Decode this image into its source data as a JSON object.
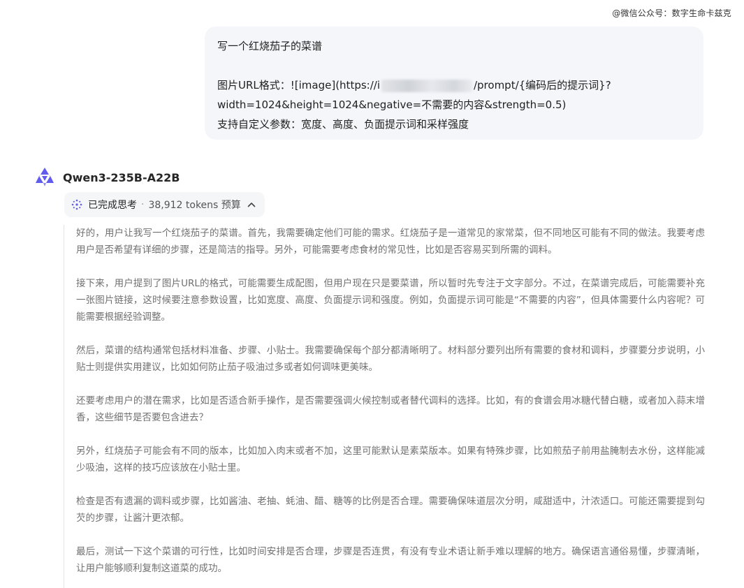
{
  "watermark": "@微信公众号：数字生命卡兹克",
  "user_message": {
    "line1": "写一个红烧茄子的菜谱",
    "line2_before": "图片URL格式：![image](https://i",
    "line2_after": "/prompt/{编码后的提示词}?",
    "line3": "width=1024&height=1024&negative=不需要的内容&strength=0.5)",
    "line4": "支持自定义参数：宽度、高度、负面提示词和采样强度"
  },
  "assistant": {
    "logo_icon": "qwen-logo-icon",
    "model_name": "Qwen3-235B-A22B",
    "logo_color": "#615ced"
  },
  "thinking": {
    "icon": "sparkle-thinking-icon",
    "status": "已完成思考",
    "separator": "·",
    "tokens": "38,912 tokens 预算",
    "toggle_icon": "chevron-up-icon",
    "paragraphs": [
      "好的，用户让我写一个红烧茄子的菜谱。首先，我需要确定他们可能的需求。红烧茄子是一道常见的家常菜，但不同地区可能有不同的做法。我要考虑用户是否希望有详细的步骤，还是简洁的指导。另外，可能需要考虑食材的常见性，比如是否容易买到所需的调料。",
      "接下来，用户提到了图片URL的格式，可能需要生成配图，但用户现在只是要菜谱，所以暂时先专注于文字部分。不过，在菜谱完成后，可能需要补充一张图片链接，这时候要注意参数设置，比如宽度、高度、负面提示词和强度。例如，负面提示词可能是“不需要的内容”，但具体需要什么内容呢？可能需要根据经验调整。",
      "然后，菜谱的结构通常包括材料准备、步骤、小贴士。我需要确保每个部分都清晰明了。材料部分要列出所有需要的食材和调料，步骤要分步说明，小贴士则提供实用建议，比如如何防止茄子吸油过多或者如何调味更美味。",
      "还要考虑用户的潜在需求，比如是否适合新手操作，是否需要强调火候控制或者替代调料的选择。比如，有的食谱会用冰糖代替白糖，或者加入蒜末增香，这些细节是否要包含进去？",
      "另外，红烧茄子可能会有不同的版本，比如加入肉末或者不加，这里可能默认是素菜版本。如果有特殊步骤，比如煎茄子前用盐腌制去水份，这样能减少吸油，这样的技巧应该放在小贴士里。",
      "检查是否有遗漏的调料或步骤，比如酱油、老抽、蚝油、醋、糖等的比例是否合理。需要确保味道层次分明，咸甜适中，汁浓适口。可能还需要提到勾芡的步骤，让酱汁更浓郁。",
      "最后，测试一下这个菜谱的可行性，比如时间安排是否合理，步骤是否连贯，有没有专业术语让新手难以理解的地方。确保语言通俗易懂，步骤清晰，让用户能够顺利复制这道菜的成功。"
    ]
  }
}
